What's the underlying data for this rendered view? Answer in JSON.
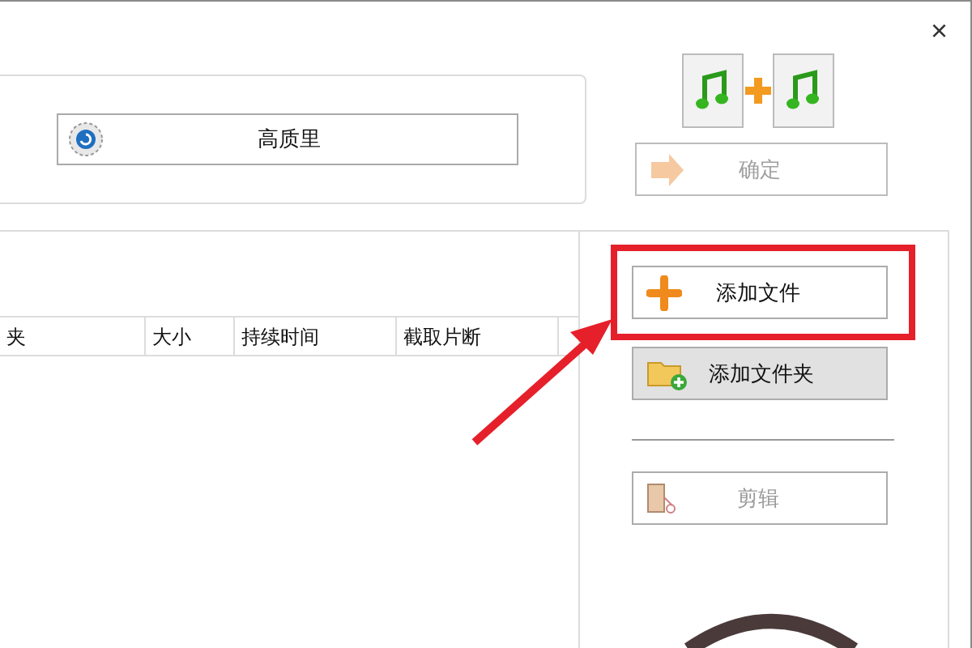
{
  "window": {
    "close": "×"
  },
  "quality_button": {
    "label": "高质里"
  },
  "confirm_button": {
    "label": "确定",
    "disabled": true
  },
  "table": {
    "columns": [
      "夹",
      "大小",
      "持续时间",
      "截取片断"
    ]
  },
  "side_buttons": [
    {
      "kind": "add-file",
      "label": "添加文件",
      "highlighted": true,
      "disabled": false
    },
    {
      "kind": "add-folder",
      "label": "添加文件夹",
      "highlighted": false,
      "disabled": false
    },
    {
      "kind": "cut",
      "label": "剪辑",
      "highlighted": false,
      "disabled": true
    }
  ]
}
